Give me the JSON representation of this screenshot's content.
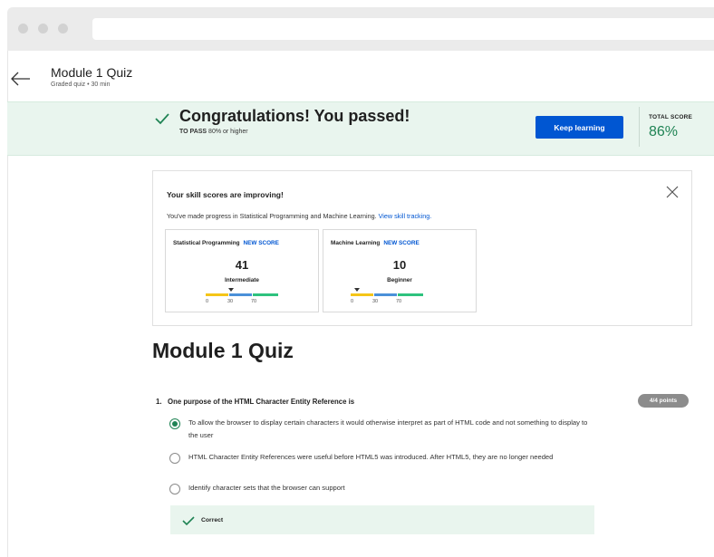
{
  "header": {
    "title": "Module 1 Quiz",
    "subtitle": "Graded quiz • 30 min"
  },
  "banner": {
    "headline": "Congratulations! You passed!",
    "to_pass_label": "TO PASS",
    "to_pass_value": "80% or higher",
    "keep_learning": "Keep learning",
    "total_score_label": "TOTAL SCORE",
    "total_score_value": "86%"
  },
  "skills": {
    "title": "Your skill scores are improving!",
    "desc": "You've made progress in Statistical Programming and Machine Learning.",
    "link": "View skill tracking.",
    "cards": [
      {
        "name": "Statistical Programming",
        "badge": "NEW SCORE",
        "score": "41",
        "level": "Intermediate",
        "ticks": [
          "0",
          "30",
          "70"
        ]
      },
      {
        "name": "Machine Learning",
        "badge": "NEW SCORE",
        "score": "10",
        "level": "Beginner",
        "ticks": [
          "0",
          "30",
          "70"
        ]
      }
    ]
  },
  "quiz": {
    "title": "Module 1 Quiz",
    "question_number": "1.",
    "question": "One purpose of the HTML Character Entity Reference is",
    "points": "4/4 points",
    "options": [
      "To allow the browser to display certain characters it would otherwise interpret as part of HTML code and not something to display to the user",
      "HTML Character Entity References were useful before HTML5 was introduced. After HTML5, they are no longer needed",
      "Identify character sets that the browser can support"
    ],
    "selected_index": 0,
    "feedback": "Correct"
  },
  "colors": {
    "accent": "#0056d2",
    "success": "#1f8354",
    "banner_bg": "#e9f5ee",
    "bar_yellow": "#f5c518",
    "bar_blue": "#4a90d9",
    "bar_green": "#2ec27e"
  },
  "icons": [
    "back-arrow-icon",
    "checkmark-icon",
    "close-icon",
    "pointer-triangle-icon"
  ]
}
